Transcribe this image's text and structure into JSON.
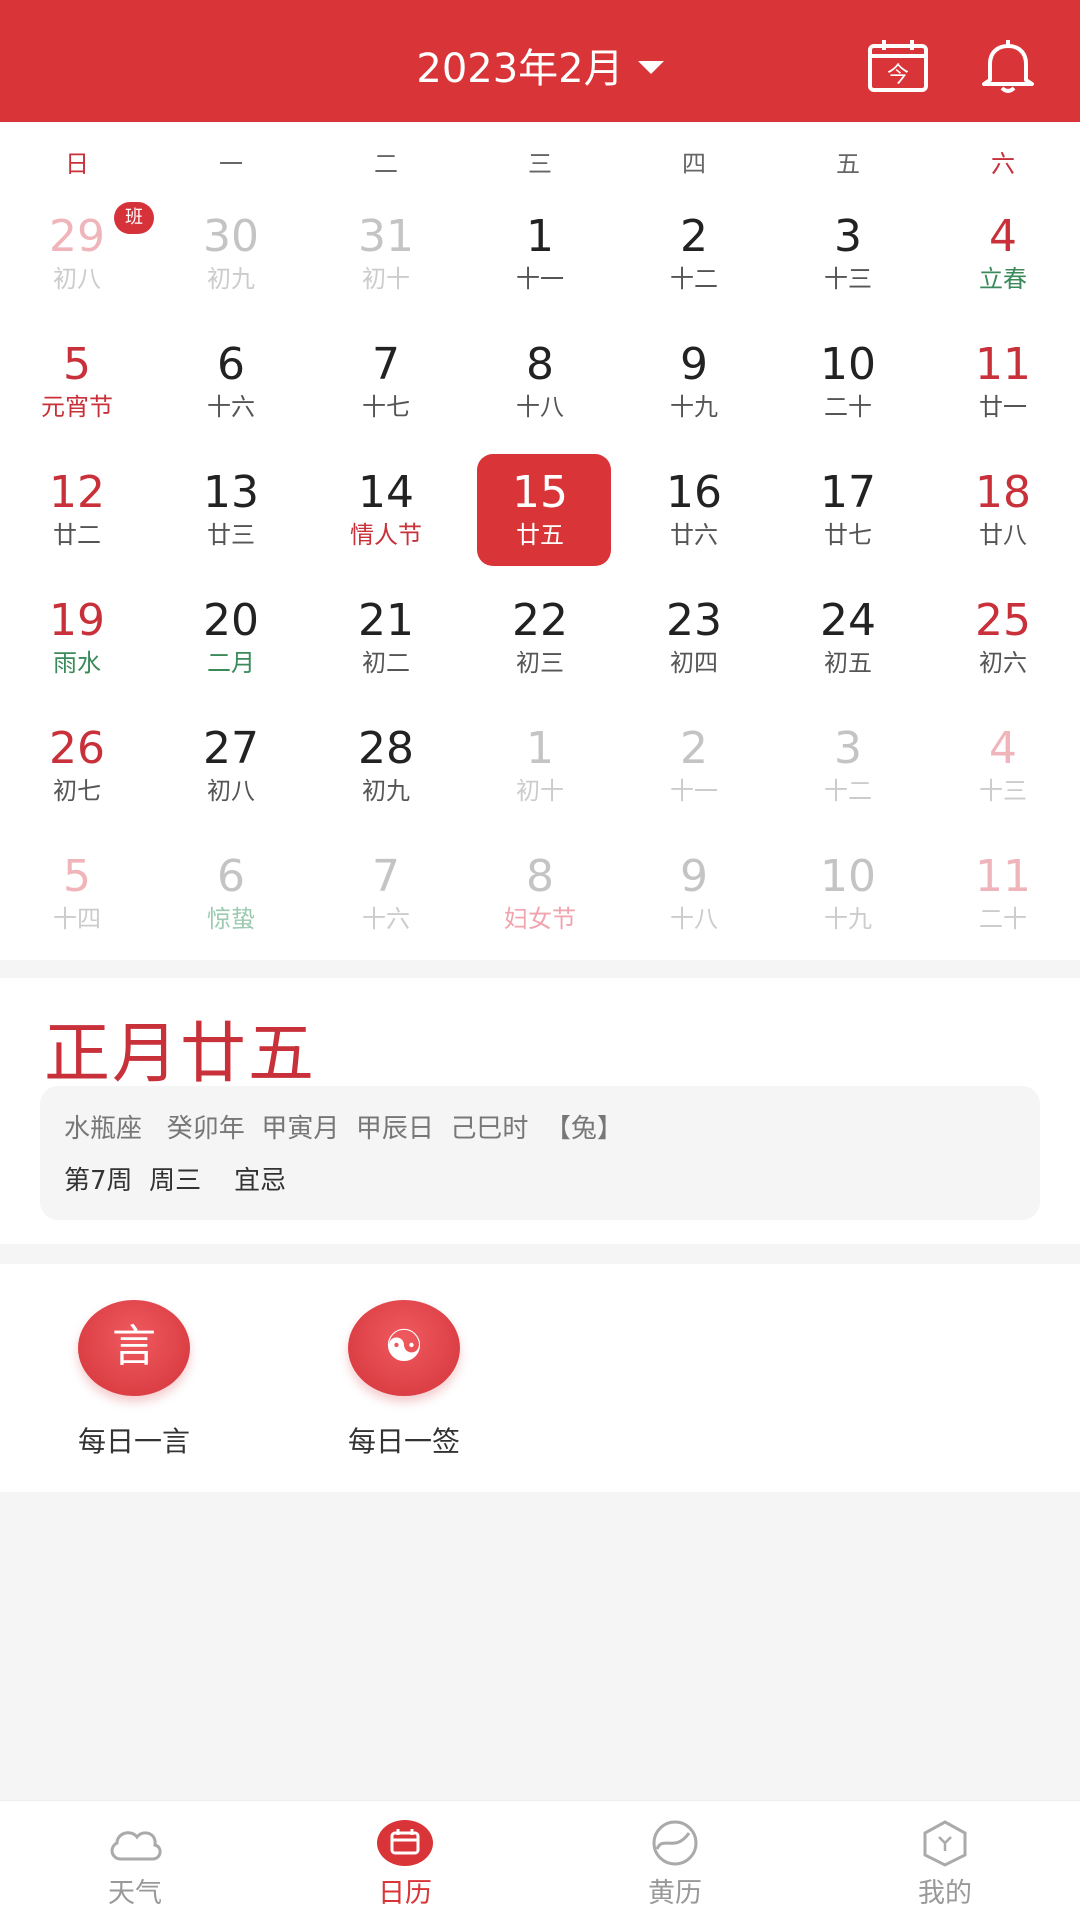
{
  "header": {
    "title": "2023年2月",
    "today_icon_text": "今",
    "colors": {
      "brand": "#d93437"
    }
  },
  "weekdays": [
    "日",
    "一",
    "二",
    "三",
    "四",
    "五",
    "六"
  ],
  "days": [
    {
      "num": "29",
      "sub": "初八",
      "dim": true,
      "badge": "班"
    },
    {
      "num": "30",
      "sub": "初九",
      "dim": true
    },
    {
      "num": "31",
      "sub": "初十",
      "dim": true
    },
    {
      "num": "1",
      "sub": "十一"
    },
    {
      "num": "2",
      "sub": "十二"
    },
    {
      "num": "3",
      "sub": "十三"
    },
    {
      "num": "4",
      "sub": "立春",
      "subcolor": "green"
    },
    {
      "num": "5",
      "sub": "元宵节",
      "subcolor": "red"
    },
    {
      "num": "6",
      "sub": "十六"
    },
    {
      "num": "7",
      "sub": "十七"
    },
    {
      "num": "8",
      "sub": "十八"
    },
    {
      "num": "9",
      "sub": "十九"
    },
    {
      "num": "10",
      "sub": "二十"
    },
    {
      "num": "11",
      "sub": "廿一"
    },
    {
      "num": "12",
      "sub": "廿二"
    },
    {
      "num": "13",
      "sub": "廿三"
    },
    {
      "num": "14",
      "sub": "情人节",
      "subcolor": "red"
    },
    {
      "num": "15",
      "sub": "廿五",
      "selected": true
    },
    {
      "num": "16",
      "sub": "廿六"
    },
    {
      "num": "17",
      "sub": "廿七"
    },
    {
      "num": "18",
      "sub": "廿八"
    },
    {
      "num": "19",
      "sub": "雨水",
      "subcolor": "green"
    },
    {
      "num": "20",
      "sub": "二月",
      "subcolor": "green"
    },
    {
      "num": "21",
      "sub": "初二"
    },
    {
      "num": "22",
      "sub": "初三"
    },
    {
      "num": "23",
      "sub": "初四"
    },
    {
      "num": "24",
      "sub": "初五"
    },
    {
      "num": "25",
      "sub": "初六"
    },
    {
      "num": "26",
      "sub": "初七"
    },
    {
      "num": "27",
      "sub": "初八"
    },
    {
      "num": "28",
      "sub": "初九"
    },
    {
      "num": "1",
      "sub": "初十",
      "dim": true
    },
    {
      "num": "2",
      "sub": "十一",
      "dim": true
    },
    {
      "num": "3",
      "sub": "十二",
      "dim": true
    },
    {
      "num": "4",
      "sub": "十三",
      "dim": true
    },
    {
      "num": "5",
      "sub": "十四",
      "dim": true
    },
    {
      "num": "6",
      "sub": "惊蛰",
      "dim": true,
      "subcolor": "green"
    },
    {
      "num": "7",
      "sub": "十六",
      "dim": true
    },
    {
      "num": "8",
      "sub": "妇女节",
      "dim": true,
      "subcolor": "red"
    },
    {
      "num": "9",
      "sub": "十八",
      "dim": true
    },
    {
      "num": "10",
      "sub": "十九",
      "dim": true
    },
    {
      "num": "11",
      "sub": "二十",
      "dim": true
    }
  ],
  "lunar": {
    "title": "正月廿五",
    "line1": "水瓶座   癸卯年  甲寅月  甲辰日  己巳时  【兔】",
    "line2": "第7周  周三    宜忌"
  },
  "tools": [
    {
      "glyph": "言",
      "label": "每日一言"
    },
    {
      "glyph": "☯",
      "label": "每日一签"
    }
  ],
  "nav": [
    {
      "label": "天气",
      "icon": "cloud-icon"
    },
    {
      "label": "日历",
      "icon": "calendar-icon",
      "active": true
    },
    {
      "label": "黄历",
      "icon": "yin-yang-icon"
    },
    {
      "label": "我的",
      "icon": "profile-hex-icon"
    }
  ]
}
